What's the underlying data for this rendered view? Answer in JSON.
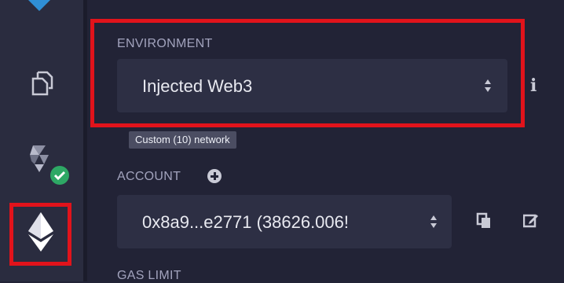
{
  "environment": {
    "label": "ENVIRONMENT",
    "selected": "Injected Web3",
    "network_badge": "Custom (10) network"
  },
  "account": {
    "label": "ACCOUNT",
    "selected": "0x8a9...e2771 (38626.006!"
  },
  "gas_limit": {
    "label": "GAS LIMIT"
  },
  "sidebar": {
    "icons": [
      "file-explorer-icon",
      "solidity-compiler-icon",
      "deploy-run-icon"
    ]
  },
  "colors": {
    "highlight": "#e1131b",
    "sidebar_bg": "#2a2c3f",
    "panel_bg": "#222336",
    "select_bg": "#2d2f44",
    "check_green": "#2ea865"
  }
}
